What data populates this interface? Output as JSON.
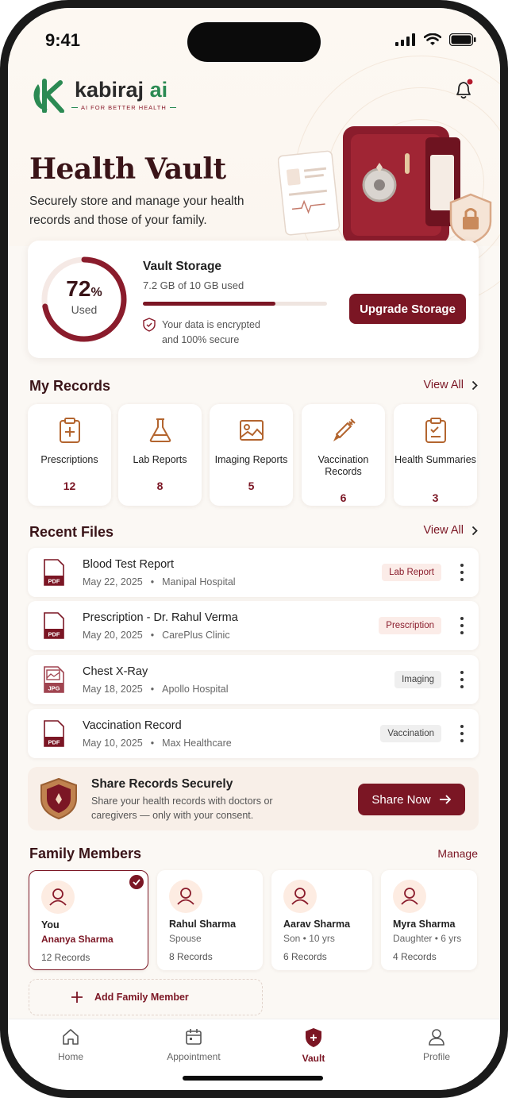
{
  "status": {
    "time": "9:41"
  },
  "brand": {
    "name_main": "kabiraj",
    "name_ai": "ai",
    "tagline": "AI FOR BETTER HEALTH"
  },
  "page": {
    "title": "Health Vault",
    "subtitle": "Securely store and manage your health records and those of your family."
  },
  "storage": {
    "percent": "72",
    "percent_sign": "%",
    "percent_value": 0.72,
    "used_label": "Used",
    "title": "Vault Storage",
    "usage": "7.2 GB of 10 GB used",
    "encryption_line1": "Your data is encrypted",
    "encryption_line2": "and 100% secure",
    "upgrade_label": "Upgrade Storage"
  },
  "records": {
    "title": "My Records",
    "view_all": "View All",
    "items": [
      {
        "label": "Prescriptions",
        "count": "12",
        "icon": "prescription-icon"
      },
      {
        "label": "Lab Reports",
        "count": "8",
        "icon": "flask-icon"
      },
      {
        "label": "Imaging Reports",
        "count": "5",
        "icon": "image-icon"
      },
      {
        "label": "Vaccination Records",
        "count": "6",
        "icon": "syringe-icon"
      },
      {
        "label": "Health Summaries",
        "count": "3",
        "icon": "clipboard-icon"
      }
    ]
  },
  "recent": {
    "title": "Recent Files",
    "view_all": "View All",
    "files": [
      {
        "name": "Blood Test Report",
        "date": "May 22, 2025",
        "source": "Manipal Hospital",
        "type": "PDF",
        "tag": "Lab Report"
      },
      {
        "name": "Prescription - Dr. Rahul Verma",
        "date": "May 20, 2025",
        "source": "CarePlus Clinic",
        "type": "PDF",
        "tag": "Prescription"
      },
      {
        "name": "Chest X-Ray",
        "date": "May 18, 2025",
        "source": "Apollo Hospital",
        "type": "JPG",
        "tag": "Imaging"
      },
      {
        "name": "Vaccination Record",
        "date": "May 10, 2025",
        "source": "Max Healthcare",
        "type": "PDF",
        "tag": "Vaccination"
      }
    ]
  },
  "share": {
    "title": "Share Records Securely",
    "subtitle": "Share your health records with doctors or caregivers — only with your consent.",
    "button": "Share Now"
  },
  "family": {
    "title": "Family Members",
    "manage": "Manage",
    "members": [
      {
        "name": "You",
        "relation": "Ananya Sharma",
        "records": "12 Records"
      },
      {
        "name": "Rahul Sharma",
        "relation": "Spouse",
        "records": "8 Records"
      },
      {
        "name": "Aarav Sharma",
        "relation": "Son • 10 yrs",
        "records": "6 Records"
      },
      {
        "name": "Myra Sharma",
        "relation": "Daughter • 6 yrs",
        "records": "4 Records"
      }
    ],
    "add_label": "Add Family Member"
  },
  "nav": {
    "items": [
      {
        "label": "Home",
        "icon": "home-icon"
      },
      {
        "label": "Appointment",
        "icon": "calendar-icon"
      },
      {
        "label": "Vault",
        "icon": "shield-icon"
      },
      {
        "label": "Profile",
        "icon": "user-icon"
      }
    ],
    "active": "Vault"
  },
  "colors": {
    "accent": "#7b1624",
    "brand_green": "#2b8a53",
    "background": "#fbf8f4"
  }
}
